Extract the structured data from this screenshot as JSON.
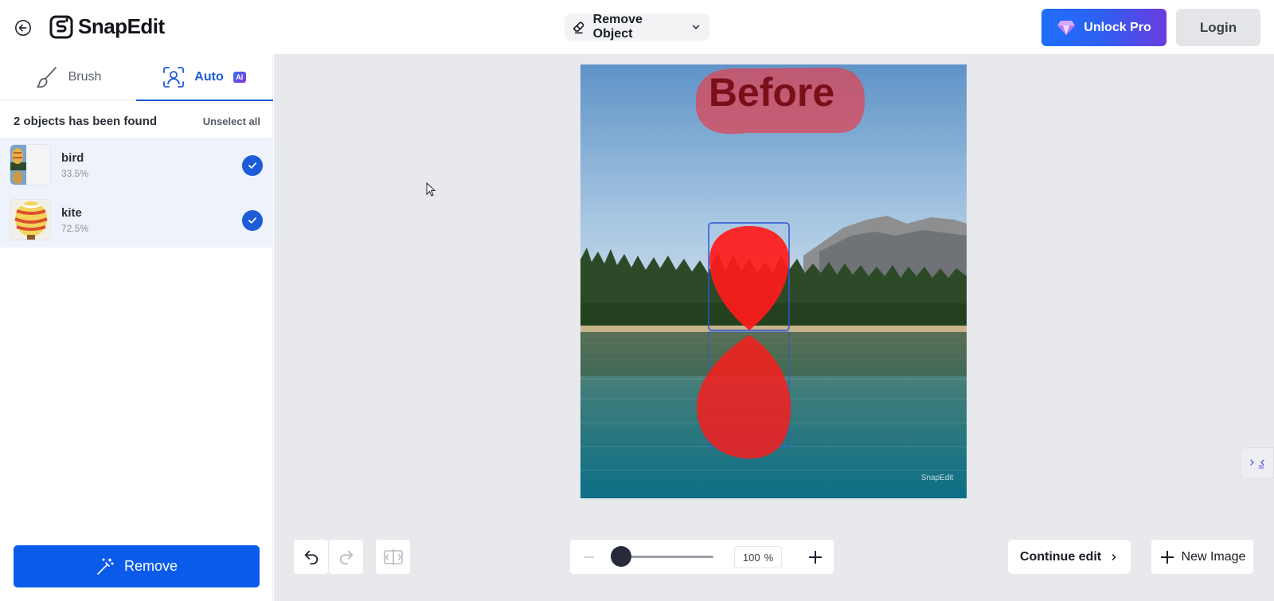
{
  "header": {
    "logo_text": "SnapEdit",
    "mode_label": "Remove Object",
    "unlock_label": "Unlock Pro",
    "login_label": "Login"
  },
  "sidebar": {
    "tabs": [
      {
        "label": "Brush",
        "icon": "brush-icon"
      },
      {
        "label": "Auto",
        "icon": "face-scan-icon",
        "badge": "AI"
      }
    ],
    "found_text": "2 objects has been found",
    "unselect_label": "Unselect all",
    "objects": [
      {
        "name": "bird",
        "confidence": "33.5%",
        "selected": true
      },
      {
        "name": "kite",
        "confidence": "72.5%",
        "selected": true
      }
    ],
    "remove_label": "Remove"
  },
  "canvas": {
    "overlay_text": "Before",
    "watermark": "SnapEdit"
  },
  "toolbar": {
    "zoom_value": "100",
    "zoom_unit": "%",
    "zoom_level_fraction": 0.0,
    "continue_label": "Continue edit",
    "new_image_label": "New Image"
  },
  "colors": {
    "accent": "#1e5bd8",
    "remove_button": "#0b5bea",
    "mask_red": "#ff1a1a"
  }
}
